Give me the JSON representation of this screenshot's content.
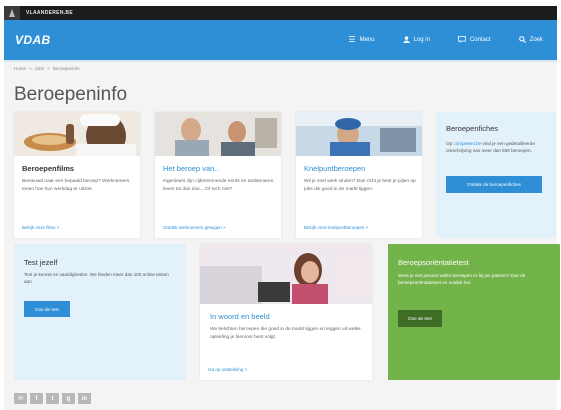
{
  "topstrip": {
    "label": "VLAANDEREN.BE"
  },
  "nav": {
    "brand": "VDAB",
    "items": [
      {
        "label": "Menu",
        "icon": "menu-icon",
        "glyph": "☰"
      },
      {
        "label": "Log in",
        "icon": "user-icon",
        "glyph": "👤"
      },
      {
        "label": "Contact",
        "icon": "chat-icon",
        "glyph": "✉"
      },
      {
        "label": "Zoek",
        "icon": "search-icon",
        "glyph": "🔍"
      }
    ]
  },
  "breadcrumb": [
    "Home",
    ">",
    "Jobs",
    ">",
    "Beroepeninfo"
  ],
  "page_title": "Beroepeninfo",
  "cards": {
    "films": {
      "title": "Beroepenfilms",
      "text": "Benieuwd naar een bepaald beroep? Werknemers tonen hoe hun werkdag er uitziet.",
      "link": "Bekijk onze films  >"
    },
    "beroep": {
      "title": "Het beroep van..",
      "text": "Ingenieurs zijn cijferminnende nerds en ambtenaren leven tot dan doe... Of toch niet?",
      "link": "Ontdek werknemers getuigen  >"
    },
    "knelpunt": {
      "title": "Knelpuntberoepen",
      "text": "Wil je snel werk vinden? Dan richt je best je pijlen op jobs die goed in de markt liggen.",
      "link": "Bekijk onze knelpuntberoepen  >"
    },
    "woord": {
      "title": "In woord en beeld",
      "text": "We belichten beroepen die goed in de markt liggen en leggen uit welke opleiding je hiervoor best volgt.",
      "link": "Ga op ontdekking  >"
    }
  },
  "fiches": {
    "title": "Beroepenfiches",
    "text_prefix": "Op ",
    "text_link": "competent.be",
    "text_suffix": " vind je een gedetailleerde omschrijving van meer dan 500 beroepen.",
    "button": "Ontdek de beroepenfiches"
  },
  "test": {
    "title": "Test jezelf",
    "text": "Test je kennis en vaardigheden. We bieden meer dan 100 online testen aan.",
    "button": "Doe de test"
  },
  "orient": {
    "title": "Beroepsoriëntatietest",
    "text": "Weet je niet precies welke beroepen er bij jou passen? Doe de beroepsoriëntatietest en ontdek het.",
    "button": "Doe de test"
  },
  "social": [
    "✉",
    "f",
    "t",
    "g",
    "in"
  ],
  "colors": {
    "brand_blue": "#2e8fd6",
    "light_blue": "#e3f1fa",
    "green": "#72b34a",
    "dark_green": "#3e6d26"
  }
}
